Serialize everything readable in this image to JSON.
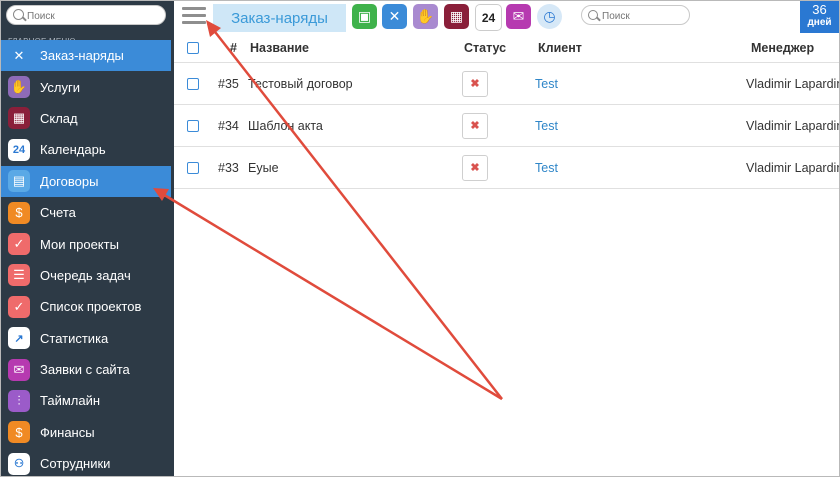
{
  "sidebar": {
    "search_placeholder": "Поиск",
    "menu_header": "ГЛАВНОЕ МЕНЮ",
    "items": [
      {
        "label": "Заказ-наряды",
        "icon": "tools-icon",
        "glyph": "✕",
        "color": "#3b8bd8",
        "active": true
      },
      {
        "label": "Услуги",
        "icon": "handshake-icon",
        "glyph": "✋",
        "color": "#8e6bb8",
        "active": false
      },
      {
        "label": "Склад",
        "icon": "warehouse-icon",
        "glyph": "▦",
        "color": "#8a1f3a",
        "active": false
      },
      {
        "label": "Календарь",
        "icon": "calendar-icon",
        "glyph": "24",
        "color": "#ffffff",
        "active": false
      },
      {
        "label": "Договоры",
        "icon": "document-icon",
        "glyph": "▤",
        "color": "#5aa9e6",
        "active": true
      },
      {
        "label": "Счета",
        "icon": "invoice-icon",
        "glyph": "$",
        "color": "#f08a24",
        "active": false
      },
      {
        "label": "Мои проекты",
        "icon": "check-icon",
        "glyph": "✓",
        "color": "#ef6b6b",
        "active": false
      },
      {
        "label": "Очередь задач",
        "icon": "list-icon",
        "glyph": "☰",
        "color": "#ef6b6b",
        "active": false
      },
      {
        "label": "Список проектов",
        "icon": "check-icon",
        "glyph": "✓",
        "color": "#ef6b6b",
        "active": false
      },
      {
        "label": "Статистика",
        "icon": "chart-icon",
        "glyph": "↗",
        "color": "#ffffff",
        "active": false
      },
      {
        "label": "Заявки с сайта",
        "icon": "mail-icon",
        "glyph": "✉",
        "color": "#b63ab0",
        "active": false
      },
      {
        "label": "Таймлайн",
        "icon": "sliders-icon",
        "glyph": "⫶",
        "color": "#9b5bc9",
        "active": false
      },
      {
        "label": "Финансы",
        "icon": "finance-icon",
        "glyph": "$",
        "color": "#f08a24",
        "active": false
      },
      {
        "label": "Сотрудники",
        "icon": "people-icon",
        "glyph": "⚇",
        "color": "#ffffff",
        "active": false
      }
    ]
  },
  "topbar": {
    "page_title": "Заказ-наряды",
    "search_placeholder": "Поиск",
    "quick_icons": [
      {
        "name": "contacts-icon",
        "glyph": "▣",
        "color": "#3fb24b"
      },
      {
        "name": "tools-icon",
        "glyph": "✕",
        "color": "#3b8bd8"
      },
      {
        "name": "handshake-icon",
        "glyph": "✋",
        "color": "#a98ad0"
      },
      {
        "name": "warehouse-icon",
        "glyph": "▦",
        "color": "#8a1f3a"
      },
      {
        "name": "calendar-icon",
        "glyph": "24",
        "color": "#ffffff"
      },
      {
        "name": "mail-icon",
        "glyph": "✉",
        "color": "#b63ab0"
      },
      {
        "name": "clock-icon",
        "glyph": "◷",
        "color": "#d6e8f7"
      }
    ],
    "days_count": "36",
    "days_label": "дней"
  },
  "table": {
    "headers": {
      "num": "#",
      "name": "Название",
      "status": "Статус",
      "client": "Клиент",
      "manager": "Менеджер"
    },
    "rows": [
      {
        "num": "#35",
        "name": "Тестовый договор",
        "status": "✖",
        "client": "Test",
        "manager": "Vladimir Lapardin"
      },
      {
        "num": "#34",
        "name": "Шаблон акта",
        "status": "✖",
        "client": "Test",
        "manager": "Vladimir Lapardin"
      },
      {
        "num": "#33",
        "name": "Еуые",
        "status": "✖",
        "client": "Test",
        "manager": "Vladimir Lapardin"
      }
    ]
  },
  "annotation_color": "#e04b3c"
}
